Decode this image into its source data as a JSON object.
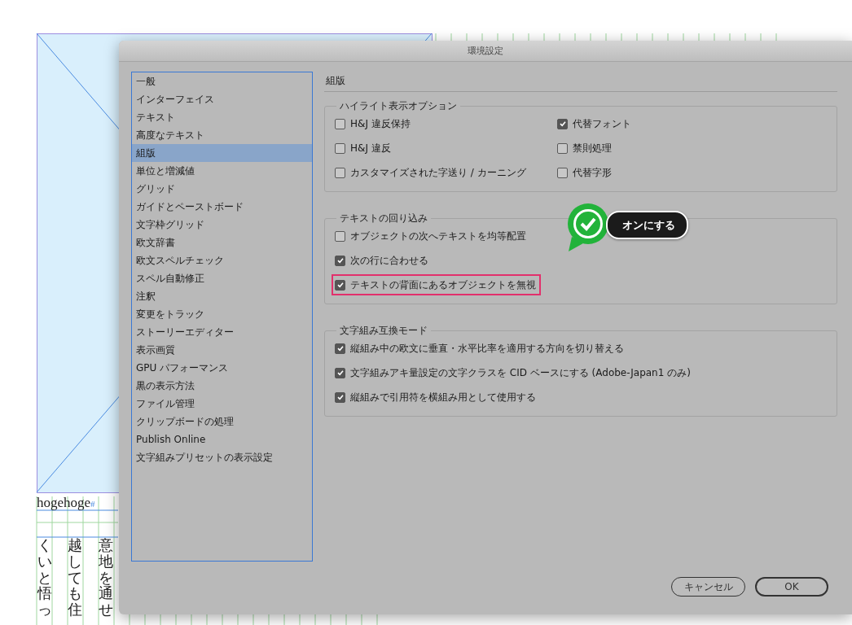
{
  "document": {
    "frame_text": "hogehoge",
    "end_mark": "#",
    "columns": [
      "くいと悟っ",
      "越しても住",
      "意地を通せ"
    ]
  },
  "dialog": {
    "title": "環境設定",
    "sidebar": {
      "items": [
        {
          "label": "一般",
          "selected": false
        },
        {
          "label": "インターフェイス",
          "selected": false
        },
        {
          "label": "テキスト",
          "selected": false
        },
        {
          "label": "高度なテキスト",
          "selected": false
        },
        {
          "label": "組版",
          "selected": true
        },
        {
          "label": "単位と増減値",
          "selected": false
        },
        {
          "label": "グリッド",
          "selected": false
        },
        {
          "label": "ガイドとペーストボード",
          "selected": false
        },
        {
          "label": "文字枠グリッド",
          "selected": false
        },
        {
          "label": "欧文辞書",
          "selected": false
        },
        {
          "label": "欧文スペルチェック",
          "selected": false
        },
        {
          "label": "スペル自動修正",
          "selected": false
        },
        {
          "label": "注釈",
          "selected": false
        },
        {
          "label": "変更をトラック",
          "selected": false
        },
        {
          "label": "ストーリーエディター",
          "selected": false
        },
        {
          "label": "表示画質",
          "selected": false
        },
        {
          "label": "GPU パフォーマンス",
          "selected": false
        },
        {
          "label": "黒の表示方法",
          "selected": false
        },
        {
          "label": "ファイル管理",
          "selected": false
        },
        {
          "label": "クリップボードの処理",
          "selected": false
        },
        {
          "label": "Publish Online",
          "selected": false
        },
        {
          "label": "文字組みプリセットの表示設定",
          "selected": false
        }
      ]
    },
    "section_title": "組版",
    "groups": [
      {
        "title": "ハイライト表示オプション",
        "kind": "two_column",
        "options": [
          {
            "label": "H&J 違反保持",
            "checked": false,
            "highlighted": false
          },
          {
            "label": "H&J 違反",
            "checked": false,
            "highlighted": false
          },
          {
            "label": "カスタマイズされた字送り / カーニング",
            "checked": false,
            "highlighted": false
          },
          {
            "label": "代替フォント",
            "checked": true,
            "highlighted": false
          },
          {
            "label": "禁則処理",
            "checked": false,
            "highlighted": false
          },
          {
            "label": "代替字形",
            "checked": false,
            "highlighted": false
          }
        ]
      },
      {
        "title": "テキストの回り込み",
        "kind": "single_column",
        "options": [
          {
            "label": "オブジェクトの次へテキストを均等配置",
            "checked": false,
            "highlighted": false
          },
          {
            "label": "次の行に合わせる",
            "checked": true,
            "highlighted": false
          },
          {
            "label": "テキストの背面にあるオブジェクトを無視",
            "checked": true,
            "highlighted": true
          }
        ]
      },
      {
        "title": "文字組み互換モード",
        "kind": "single_column",
        "options": [
          {
            "label": "縦組み中の欧文に垂直・水平比率を適用する方向を切り替える",
            "checked": true,
            "highlighted": false
          },
          {
            "label": "文字組みアキ量設定の文字クラスを CID ベースにする (Adobe-Japan1 のみ)",
            "checked": true,
            "highlighted": false
          },
          {
            "label": "縦組みで引用符を横組み用として使用する",
            "checked": true,
            "highlighted": false
          }
        ]
      }
    ],
    "callout": {
      "text": "オンにする"
    },
    "buttons": [
      {
        "label": "キャンセル",
        "kind": "secondary"
      },
      {
        "label": "OK",
        "kind": "default"
      }
    ]
  }
}
